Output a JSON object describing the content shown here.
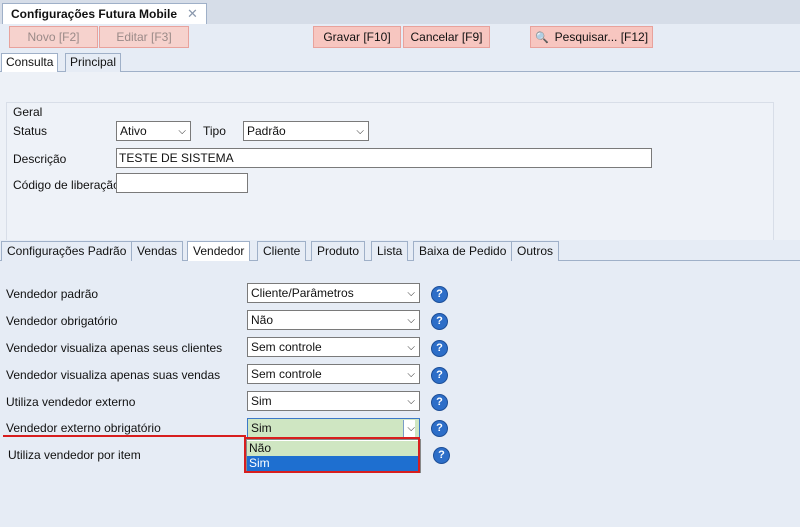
{
  "window_tab": {
    "title": "Configurações Futura Mobile",
    "close": "✕"
  },
  "toolbar": {
    "novo": "Novo [F2]",
    "editar": "Editar [F3]",
    "gravar": "Gravar [F10]",
    "cancelar": "Cancelar [F9]",
    "pesquisar": "Pesquisar... [F12]"
  },
  "main_tabs": [
    "Consulta",
    "Principal"
  ],
  "geral": {
    "section_label": "Geral",
    "status_label": "Status",
    "status_value": "Ativo",
    "tipo_label": "Tipo",
    "tipo_value": "Padrão",
    "descricao_label": "Descrição",
    "descricao_value": "TESTE DE SISTEMA",
    "codigo_label": "Código de liberação",
    "codigo_value": ""
  },
  "config_tabs": [
    "Configurações Padrão",
    "Vendas",
    "Vendedor",
    "Cliente",
    "Produto",
    "Lista",
    "Baixa de Pedido",
    "Outros"
  ],
  "vendedor": {
    "rows": [
      {
        "label": "Vendedor padrão",
        "value": "Cliente/Parâmetros"
      },
      {
        "label": "Vendedor obrigatório",
        "value": "Não"
      },
      {
        "label": "Vendedor visualiza apenas seus clientes",
        "value": "Sem controle"
      },
      {
        "label": "Vendedor visualiza apenas suas vendas",
        "value": "Sem controle"
      },
      {
        "label": "Utiliza vendedor externo",
        "value": "Sim"
      },
      {
        "label": "Vendedor externo obrigatório",
        "value": "Sim"
      },
      {
        "label": "Utiliza vendedor por item",
        "value": ""
      }
    ],
    "dropdown_options": [
      "Não",
      "Sim"
    ]
  },
  "colors": {
    "accent_red": "#d81e1e",
    "selected_blue": "#1e6fd0",
    "open_select_green": "#cfe6c2"
  }
}
